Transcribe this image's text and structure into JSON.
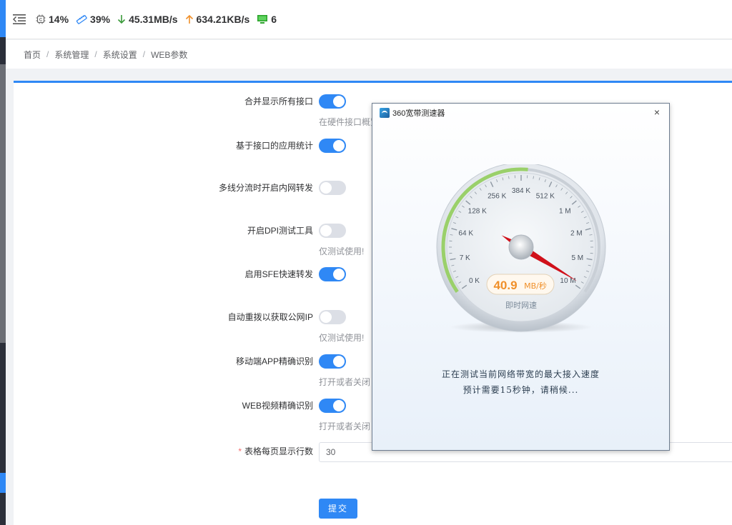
{
  "topbar": {
    "cpu": "14%",
    "memory": "39%",
    "download": "45.31MB/s",
    "upload": "634.21KB/s",
    "online": "6"
  },
  "breadcrumb": [
    "首页",
    "系统管理",
    "系统设置",
    "WEB参数"
  ],
  "form": {
    "rows": [
      {
        "label": "合并显示所有接口",
        "on": true,
        "hint": "在硬件接口概览"
      },
      {
        "label": "基于接口的应用统计",
        "on": true,
        "hint": ""
      },
      {
        "label": "多线分流时开启内网转发",
        "on": false,
        "hint": ""
      },
      {
        "label": "开启DPI测试工具",
        "on": false,
        "hint": "仅测试使用!"
      },
      {
        "label": "启用SFE快速转发",
        "on": true,
        "hint": ""
      },
      {
        "label": "自动重拨以获取公网IP",
        "on": false,
        "hint": "仅测试使用!"
      },
      {
        "label": "移动端APP精确识别",
        "on": true,
        "hint": "打开或者关闭"
      },
      {
        "label": "WEB视频精确识别",
        "on": true,
        "hint": "打开或者关闭"
      }
    ],
    "rows_per_page_label": "表格每页显示行数",
    "rows_per_page_value": "30",
    "submit_label": "提交"
  },
  "dialog": {
    "title": "360宽带测速器",
    "close": "×",
    "gauge_ticks": [
      "0 K",
      "7 K",
      "64 K",
      "128 K",
      "256 K",
      "384 K",
      "512 K",
      "1 M",
      "2 M",
      "5 M",
      "10 M"
    ],
    "speed_value": "40.9",
    "speed_unit": "MB/秒",
    "speed_caption": "即时网速",
    "message_line1": "正在测试当前网络带宽的最大接入速度",
    "message_line2": "预计需要15秒钟，请稍候...",
    "colors": {
      "accent_green": "#9ad06a",
      "needle": "#d0101a",
      "speed_text": "#f0902a"
    }
  }
}
